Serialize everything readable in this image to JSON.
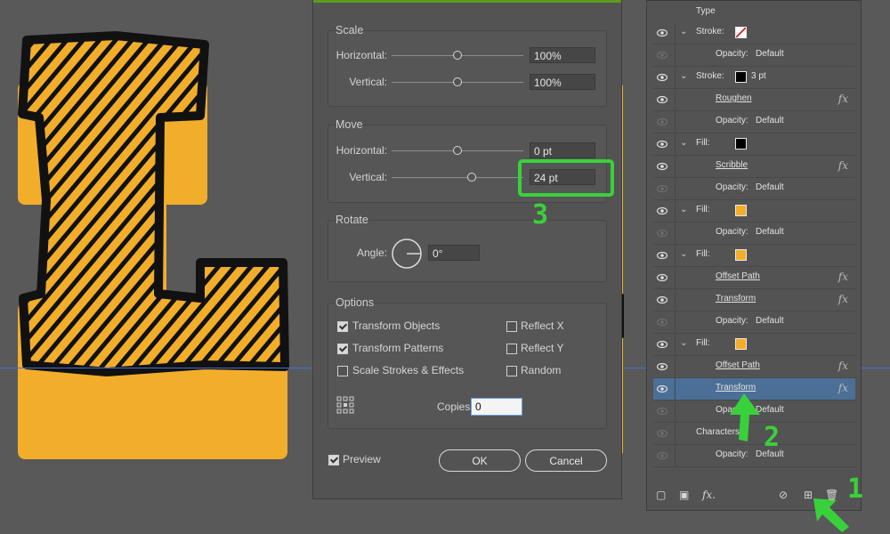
{
  "dialog": {
    "scale": {
      "title": "Scale",
      "horizontal_label": "Horizontal:",
      "horizontal_value": "100%",
      "vertical_label": "Vertical:",
      "vertical_value": "100%"
    },
    "move": {
      "title": "Move",
      "horizontal_label": "Horizontal:",
      "horizontal_value": "0 pt",
      "vertical_label": "Vertical:",
      "vertical_value": "24 pt"
    },
    "rotate": {
      "title": "Rotate",
      "angle_label": "Angle:",
      "angle_value": "0°"
    },
    "options": {
      "title": "Options",
      "transform_objects": "Transform Objects",
      "transform_patterns": "Transform Patterns",
      "scale_strokes": "Scale Strokes & Effects",
      "reflect_x": "Reflect X",
      "reflect_y": "Reflect Y",
      "random": "Random",
      "copies_label": "Copies",
      "copies_value": "0"
    },
    "preview_label": "Preview",
    "ok_label": "OK",
    "cancel_label": "Cancel"
  },
  "appearance": {
    "header": "Type",
    "rows": [
      {
        "text": "Stroke:",
        "chev": true,
        "swatch": "none",
        "extra": "",
        "ul": false,
        "fx": false,
        "eye": true
      },
      {
        "text": "Opacity:",
        "value": "Default",
        "chev": false,
        "eye": false
      },
      {
        "text": "Stroke:",
        "chev": true,
        "swatch": "#000000",
        "extra": "3 pt",
        "eye": true
      },
      {
        "text": "Roughen",
        "chev": false,
        "ul": true,
        "fx": true,
        "eye": true
      },
      {
        "text": "Opacity:",
        "value": "Default",
        "eye": false
      },
      {
        "text": "Fill:",
        "chev": true,
        "swatch": "#000000",
        "eye": true
      },
      {
        "text": "Scribble",
        "ul": true,
        "fx": true,
        "eye": true
      },
      {
        "text": "Opacity:",
        "value": "Default",
        "eye": false
      },
      {
        "text": "Fill:",
        "chev": true,
        "swatch": "#f2ae2a",
        "eye": true
      },
      {
        "text": "Opacity:",
        "value": "Default",
        "eye": false
      },
      {
        "text": "Fill:",
        "chev": true,
        "swatch": "#f2ae2a",
        "eye": true
      },
      {
        "text": "Offset Path",
        "ul": true,
        "fx": true,
        "eye": true
      },
      {
        "text": "Transform",
        "ul": true,
        "fx": true,
        "eye": true
      },
      {
        "text": "Opacity:",
        "value": "Default",
        "eye": false
      },
      {
        "text": "Fill:",
        "chev": true,
        "swatch": "#f2ae2a",
        "eye": true
      },
      {
        "text": "Offset Path",
        "ul": true,
        "fx": true,
        "eye": true
      },
      {
        "text": "Transform",
        "ul": true,
        "fx": true,
        "eye": true,
        "selected": true
      },
      {
        "text": "Opacity:",
        "value": "Default",
        "eye": false
      },
      {
        "text": "Characters",
        "eye": false
      },
      {
        "text": "Opacity:",
        "value": "Default",
        "eye": false
      }
    ]
  },
  "annotations": {
    "one": "1",
    "two": "2",
    "three": "3"
  },
  "colors": {
    "accent_green": "#39d13b",
    "fill_orange": "#f2ae2a",
    "selected_row": "#4b6f97"
  }
}
